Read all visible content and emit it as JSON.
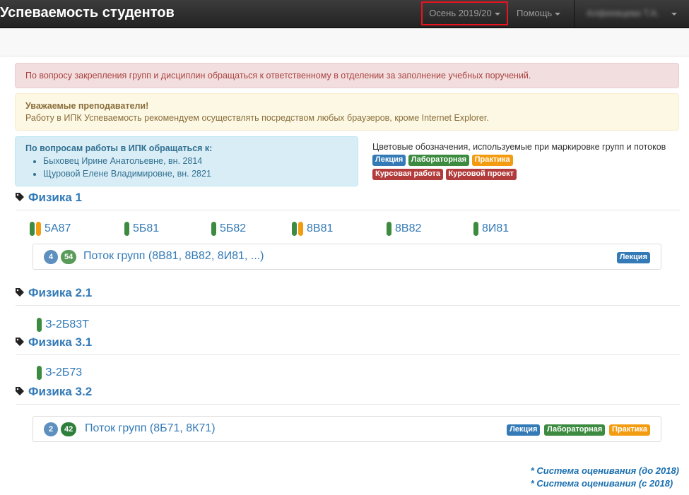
{
  "navbar": {
    "brand": "Успеваемость студентов",
    "semester": "Осень 2019/20",
    "help": "Помощь",
    "user": "Алфеевцева Т.А."
  },
  "alerts": {
    "danger": "По вопросу закрепления групп и дисциплин обращаться к ответственному в отделении за заполнение учебных поручений.",
    "warning_title": "Уважаемые преподаватели!",
    "warning_text": "Работу в ИПК Успеваемость рекомендуем осуществлять посредством любых браузеров, кроме Internet Explorer.",
    "info_title": "По вопросам работы в ИПК обращаться к:",
    "contacts": [
      "Быховец Ирине Анатольевне, вн. 2814",
      "Щуровой Елене Владимировне, вн. 2821"
    ]
  },
  "legend": {
    "title": "Цветовые обозначения, используемые при маркировке групп и потоков",
    "labels": [
      "Лекция",
      "Лабораторная",
      "Практика",
      "Курсовая работа",
      "Курсовой проект"
    ]
  },
  "sections": [
    {
      "title": "Физика 1",
      "groups": [
        {
          "name": "5А87",
          "markers": [
            "green",
            "orange"
          ]
        },
        {
          "name": "5Б81",
          "markers": [
            "green"
          ]
        },
        {
          "name": "5Б82",
          "markers": [
            "green"
          ]
        },
        {
          "name": "8В81",
          "markers": [
            "green",
            "orange"
          ]
        },
        {
          "name": "8В82",
          "markers": [
            "green"
          ]
        },
        {
          "name": "8И81",
          "markers": [
            "green"
          ]
        }
      ],
      "stream": {
        "count": "4",
        "students": "54",
        "title": "Поток групп (8В81, 8В82, 8И81, ...)",
        "labels": [
          "Лекция"
        ]
      }
    },
    {
      "title": "Физика 2.1",
      "groups": [
        {
          "name": "З-2Б83Т",
          "markers": [
            "green"
          ]
        }
      ]
    },
    {
      "title": "Физика 3.1",
      "groups": [
        {
          "name": "З-2Б73",
          "markers": [
            "green"
          ]
        }
      ]
    },
    {
      "title": "Физика 3.2",
      "groups": [],
      "stream": {
        "count": "2",
        "students": "42",
        "title": "Поток групп (8Б71, 8К71)",
        "labels": [
          "Лекция",
          "Лабораторная",
          "Практика"
        ]
      }
    }
  ],
  "footer": [
    "* Система оценивания (до 2018)",
    "* Система оценивания (с 2018)"
  ],
  "colors": {
    "danger_frame": "#e8131f",
    "link": "#337ab7",
    "lecture": "#337ab7",
    "lab": "#3d8b40",
    "practice": "#f39c12",
    "course": "#b23b3b"
  }
}
